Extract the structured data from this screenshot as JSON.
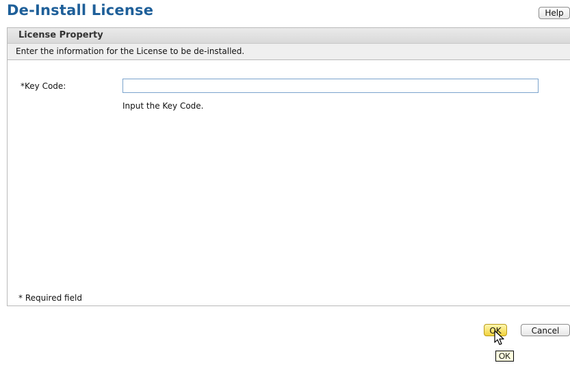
{
  "page": {
    "title": "De-Install License",
    "help_label": "Help"
  },
  "panel": {
    "header": "License Property",
    "instruction": "Enter the information for the License to be de-installed.",
    "key_code": {
      "label": "*Key Code:",
      "value": "",
      "placeholder": "",
      "hint": "Input the Key Code."
    },
    "required_note": "* Required field"
  },
  "actions": {
    "ok_label": "OK",
    "cancel_label": "Cancel",
    "tooltip": "OK"
  },
  "colors": {
    "title": "#1e5f99",
    "ok_button": "#f2d23c",
    "input_border": "#7aa3cc"
  },
  "icons": {
    "cursor": "mouse-pointer-icon"
  }
}
